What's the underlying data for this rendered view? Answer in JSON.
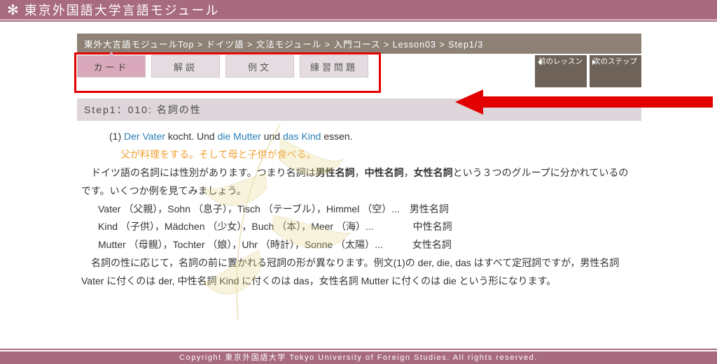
{
  "header": {
    "title": "東京外国語大学言語モジュール"
  },
  "breadcrumb": "東外大言語モジュールTop > ドイツ語 > 文法モジュール > 入門コース > Lesson03 > Step1/3",
  "tabs": [
    {
      "label": "カード",
      "active": true
    },
    {
      "label": "解説"
    },
    {
      "label": "例文"
    },
    {
      "label": "練習問題"
    }
  ],
  "nav": {
    "prev": "前のレッスン",
    "next": "次のステップ"
  },
  "step_title": "Step1：010: 名詞の性",
  "example": {
    "num": "(1)",
    "parts": [
      {
        "t": "Der Vater",
        "hl": true
      },
      {
        "t": " kocht. Und "
      },
      {
        "t": "die Mutter",
        "hl": true
      },
      {
        "t": " und "
      },
      {
        "t": "das Kind",
        "hl": true
      },
      {
        "t": " essen."
      }
    ],
    "translation": "父が料理をする。そして母と子供が食べる。"
  },
  "body": {
    "intro_a": "　ドイツ語の名詞には性別があります。つまり名詞は",
    "bold1": "男性名詞",
    "c1": "，",
    "bold2": "中性名詞",
    "c2": "，",
    "bold3": "女性名詞",
    "intro_b": "という３つのグループに分かれているのです。いくつか例を見てみましょう。",
    "row1": "Vater （父親），Sohn （息子），Tisch （テーブル），Himmel （空）...　男性名詞",
    "row2": "Kind （子供），Mädchen （少女），Buch （本），Meer （海）...　　　　中性名詞",
    "row3": "Mutter （母親），Tochter （娘），Uhr （時計），Sonne （太陽）...　　　女性名詞",
    "para2": "　名詞の性に応じて，名詞の前に置かれる冠詞の形が異なります。例文(1)の der, die, das はすべて定冠詞ですが，男性名詞 Vater に付くのは der, 中性名詞 Kind に付くのは das，女性名詞 Mutter に付くのは die という形になります。"
  },
  "footer": "Copyright 東京外国語大学 Tokyo University of Foreign Studies. All rights reserved."
}
